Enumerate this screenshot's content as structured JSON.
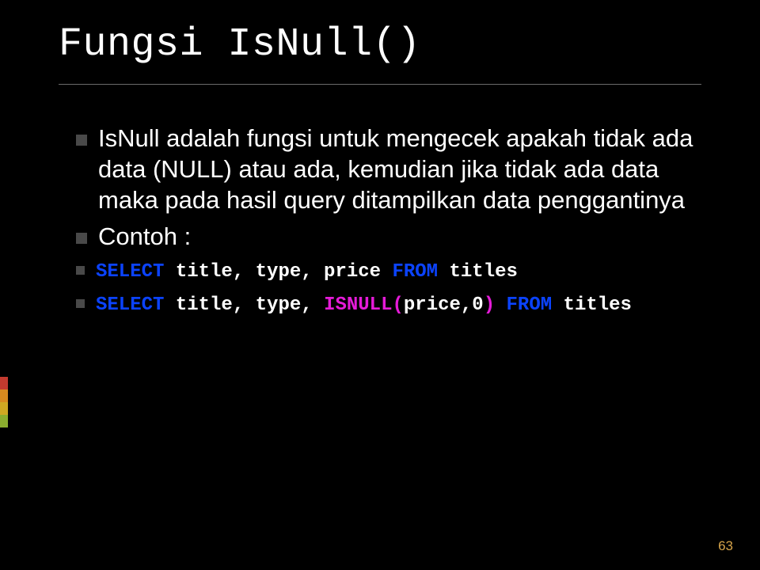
{
  "title": "Fungsi IsNull()",
  "body": {
    "para1": "IsNull adalah fungsi untuk mengecek apakah tidak ada data (NULL) atau ada, kemudian jika tidak ada data maka pada hasil query ditampilkan data penggantinya",
    "para2": "Contoh :"
  },
  "code1": {
    "kw1": "SELECT",
    "mid": " title, type, price ",
    "kw2": "FROM",
    "tail": " titles"
  },
  "code2": {
    "kw1": "SELECT",
    "mid1": " title, type, ",
    "fn": "ISNULL",
    "paren_open": "(",
    "args": "price,0",
    "paren_close": ")",
    "sp": " ",
    "kw2": "FROM",
    "tail": " titles"
  },
  "page_number": "63"
}
